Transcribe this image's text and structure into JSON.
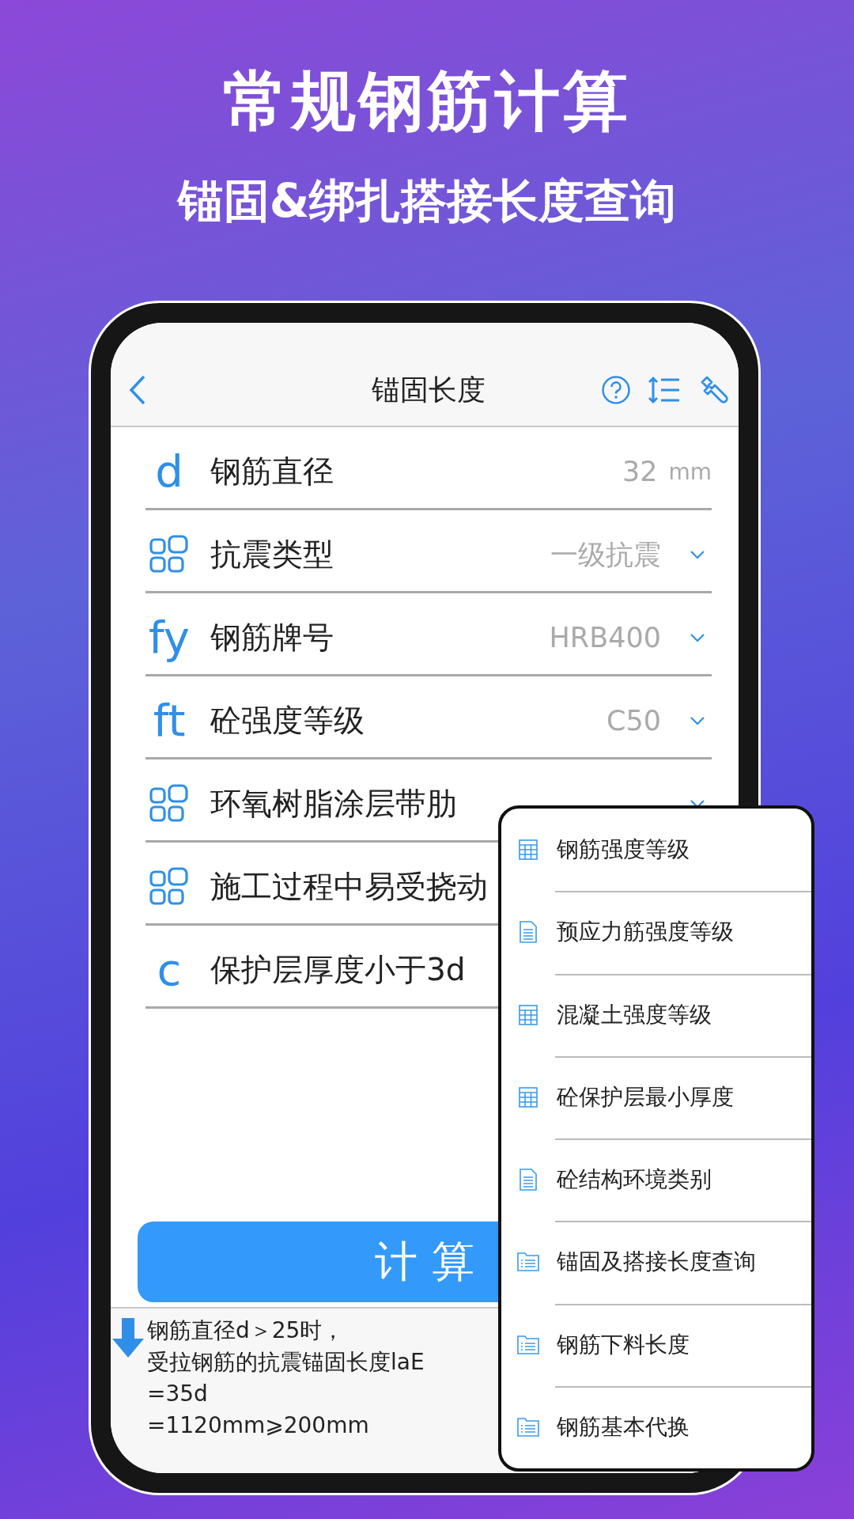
{
  "headline": "常规钢筋计算",
  "subheadline": "锚固&绑扎搭接长度查询",
  "nav": {
    "title": "锚固长度"
  },
  "rows": [
    {
      "kind": "input",
      "symbol": "d",
      "label": "钢筋直径",
      "value": "32",
      "unit": "mm"
    },
    {
      "kind": "select",
      "label": "抗震类型",
      "value": "一级抗震"
    },
    {
      "kind": "select",
      "symbol": "fy",
      "label": "钢筋牌号",
      "value": "HRB400"
    },
    {
      "kind": "select",
      "symbol": "ft",
      "label": "砼强度等级",
      "value": "C50"
    },
    {
      "kind": "select",
      "label": "环氧树脂涂层带肋"
    },
    {
      "kind": "plain",
      "label": "施工过程中易受挠动"
    },
    {
      "kind": "plain",
      "symbol": "c",
      "label": "保护层厚度小于3d"
    }
  ],
  "calculate_button": "计 算",
  "result_lines": [
    "钢筋直径d＞25时，",
    "受拉钢筋的抗震锚固长度laE",
    "=35d",
    "=1120mm⩾200mm"
  ],
  "menu": [
    {
      "kind": "table",
      "label": "钢筋强度等级"
    },
    {
      "kind": "document",
      "label": "预应力筋强度等级"
    },
    {
      "kind": "table",
      "label": "混凝土强度等级"
    },
    {
      "kind": "table",
      "label": "砼保护层最小厚度"
    },
    {
      "kind": "document",
      "label": "砼结构环境类别"
    },
    {
      "kind": "folder",
      "label": "锚固及搭接长度查询"
    },
    {
      "kind": "folder",
      "label": "钢筋下料长度"
    },
    {
      "kind": "folder",
      "label": "钢筋基本代换"
    }
  ]
}
